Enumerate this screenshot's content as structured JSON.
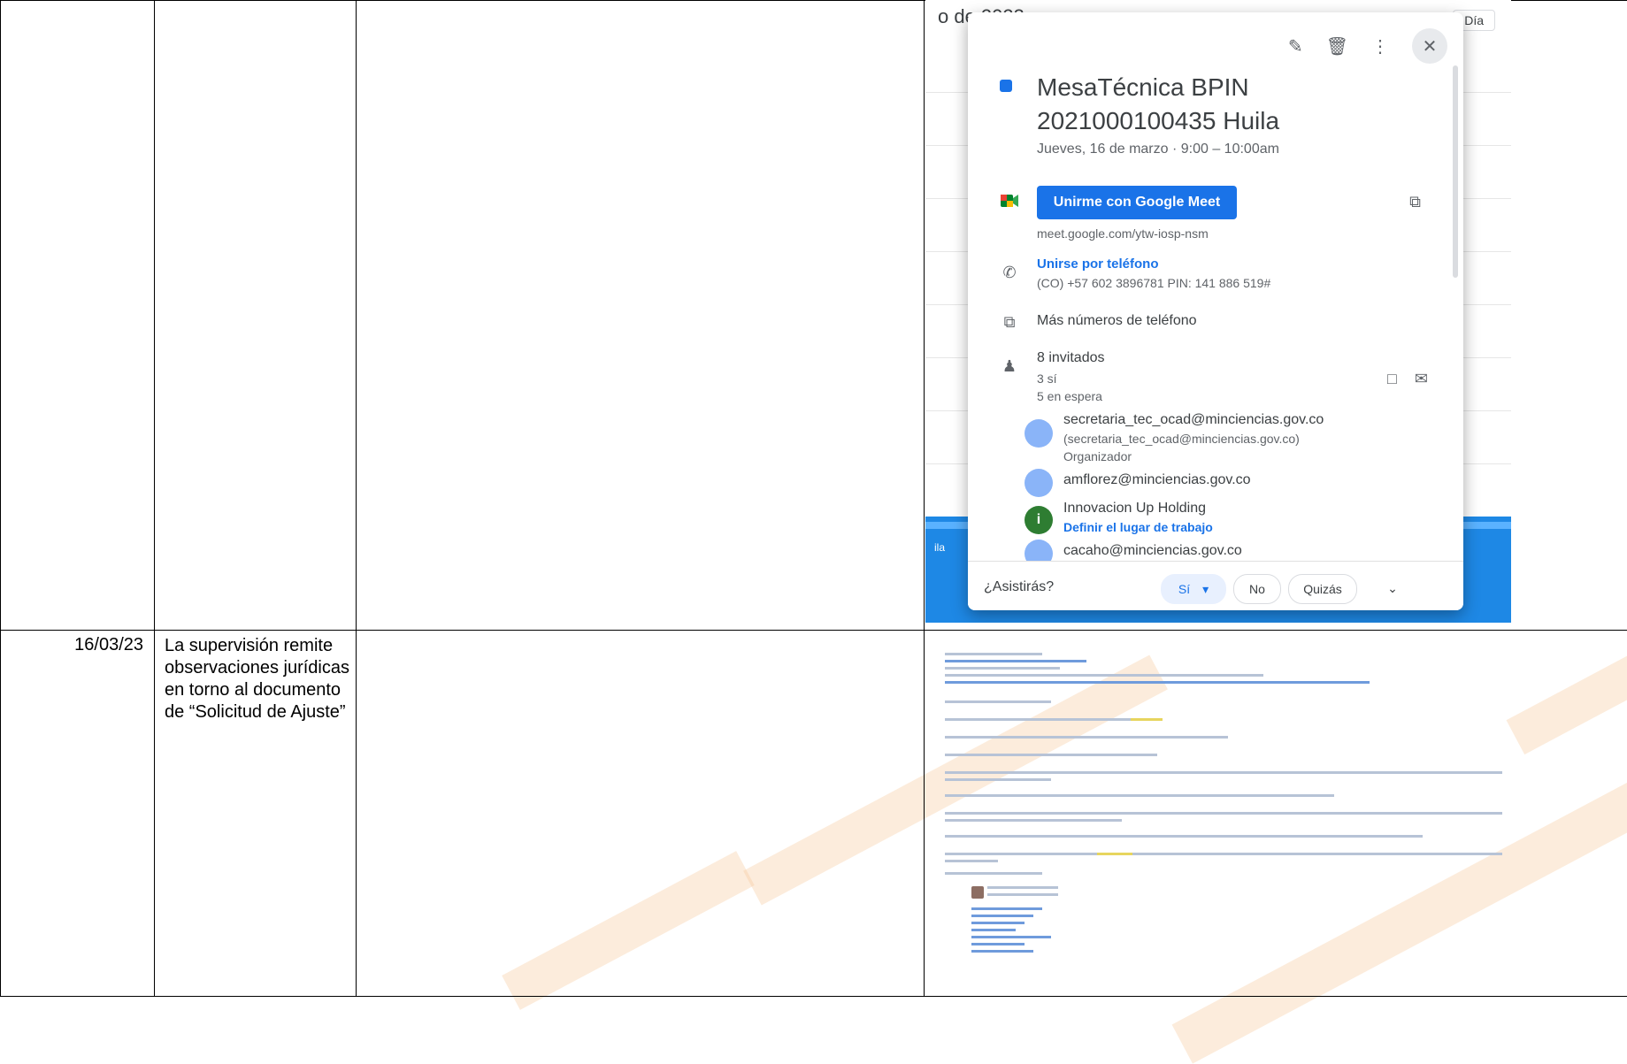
{
  "table": {
    "row2": {
      "date": "16/03/23",
      "description": "La supervisión remite observaciones jurídicas en torno al documento de “Solicitud de Ajuste”"
    }
  },
  "calendar": {
    "header_title": "o de 2023",
    "view_button": "Día",
    "day_strip_label": "ila",
    "event": {
      "title": "MesaTécnica BPIN 2021000100435 Huila",
      "when": "Jueves, 16 de marzo  ·  9:00 – 10:00am",
      "meet_button": "Unirme con Google Meet",
      "meet_link": "meet.google.com/ytw-iosp-nsm",
      "phone_link": "Unirse por teléfono",
      "phone_number": "(CO) +57 602 3896781 PIN: 141 886 519#",
      "more_phones": "Más números de teléfono",
      "guests_count": "8 invitados",
      "guests_yes": "3 sí",
      "guests_waiting": "5 en espera",
      "guests": [
        {
          "name": "secretaria_tec_ocad@minciencias.gov.co",
          "detail": "(secretaria_tec_ocad@minciencias.gov.co)",
          "role": "Organizador"
        },
        {
          "name": "amflorez@minciencias.gov.co"
        },
        {
          "name": "Innovacion Up Holding",
          "link": "Definir el lugar de trabajo",
          "initial": "i"
        },
        {
          "name": "cacaho@minciencias.gov.co"
        }
      ],
      "rsvp_question": "¿Asistirás?",
      "rsvp_yes": "Sí",
      "rsvp_no": "No",
      "rsvp_maybe": "Quizás"
    }
  },
  "colors": {
    "accent_blue": "#1a73e8",
    "watermark_orange": "#f6c89a"
  }
}
